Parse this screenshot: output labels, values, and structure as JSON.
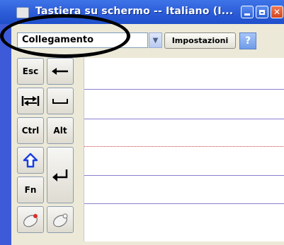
{
  "window": {
    "title": "Tastiera su schermo -- Italiano (I..."
  },
  "toolbar": {
    "mode_value": "Collegamento",
    "settings_label": "Impostazioni",
    "help_label": "?"
  },
  "keys": {
    "esc": "Esc",
    "ctrl": "Ctrl",
    "alt": "Alt",
    "fn": "Fn"
  },
  "icons": {
    "backspace": "left-arrow-icon",
    "tab": "tab-icon",
    "space": "space-icon",
    "shift": "shift-up-arrow-icon",
    "enter": "enter-icon",
    "mouse_left": "mouse-left-icon",
    "mouse_right": "mouse-right-icon"
  },
  "colors": {
    "frame": "#3d5bd9",
    "title_gradient_top": "#3f74e8",
    "shift_arrow": "#1b3fe0",
    "close_btn": "#d2461f",
    "annotation": "#000000"
  }
}
